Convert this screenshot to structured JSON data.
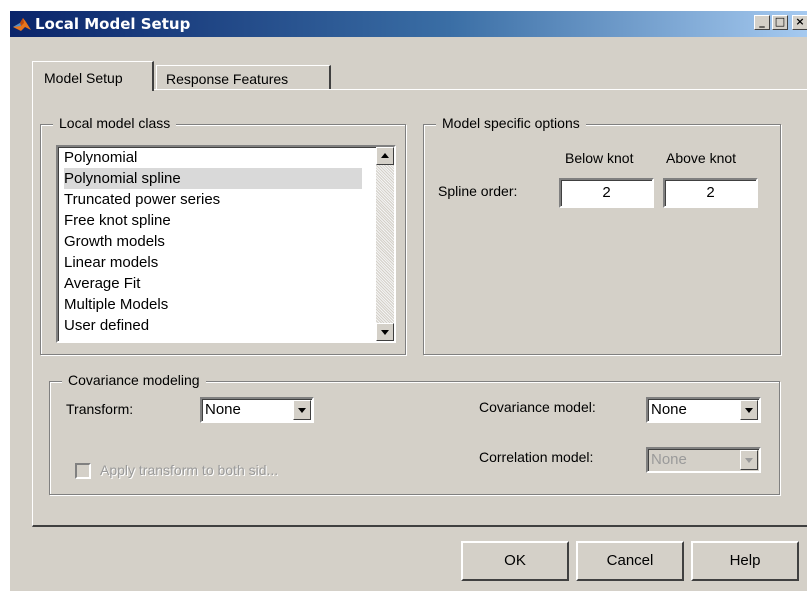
{
  "window": {
    "title": "Local Model Setup"
  },
  "title_buttons": {
    "minimize": "_",
    "maximize": "□",
    "close": "×"
  },
  "tabs": [
    {
      "label": "Model Setup",
      "active": true
    },
    {
      "label": "Response Features",
      "active": false
    }
  ],
  "local_model_class": {
    "title": "Local model class",
    "items": [
      "Polynomial",
      "Polynomial spline",
      "Truncated power series",
      "Free knot spline",
      "Growth models",
      "Linear models",
      "Average Fit",
      "Multiple Models",
      "User defined"
    ],
    "selected": "Polynomial spline"
  },
  "model_options": {
    "title": "Model specific options",
    "below_knot_label": "Below knot",
    "above_knot_label": "Above knot",
    "spline_order_label": "Spline order:",
    "below_value": "2",
    "above_value": "2"
  },
  "covariance": {
    "title": "Covariance modeling",
    "transform_label": "Transform:",
    "transform_value": "None",
    "apply_label": "Apply transform to both sid...",
    "cov_model_label": "Covariance model:",
    "cov_model_value": "None",
    "corr_model_label": "Correlation model:",
    "corr_model_value": "None"
  },
  "buttons": {
    "ok": "OK",
    "cancel": "Cancel",
    "help": "Help"
  },
  "colors": {
    "face": "#d4d0c8",
    "title_start": "#0a246a",
    "title_end": "#a6caf0",
    "selection": "#d9d9d9"
  }
}
